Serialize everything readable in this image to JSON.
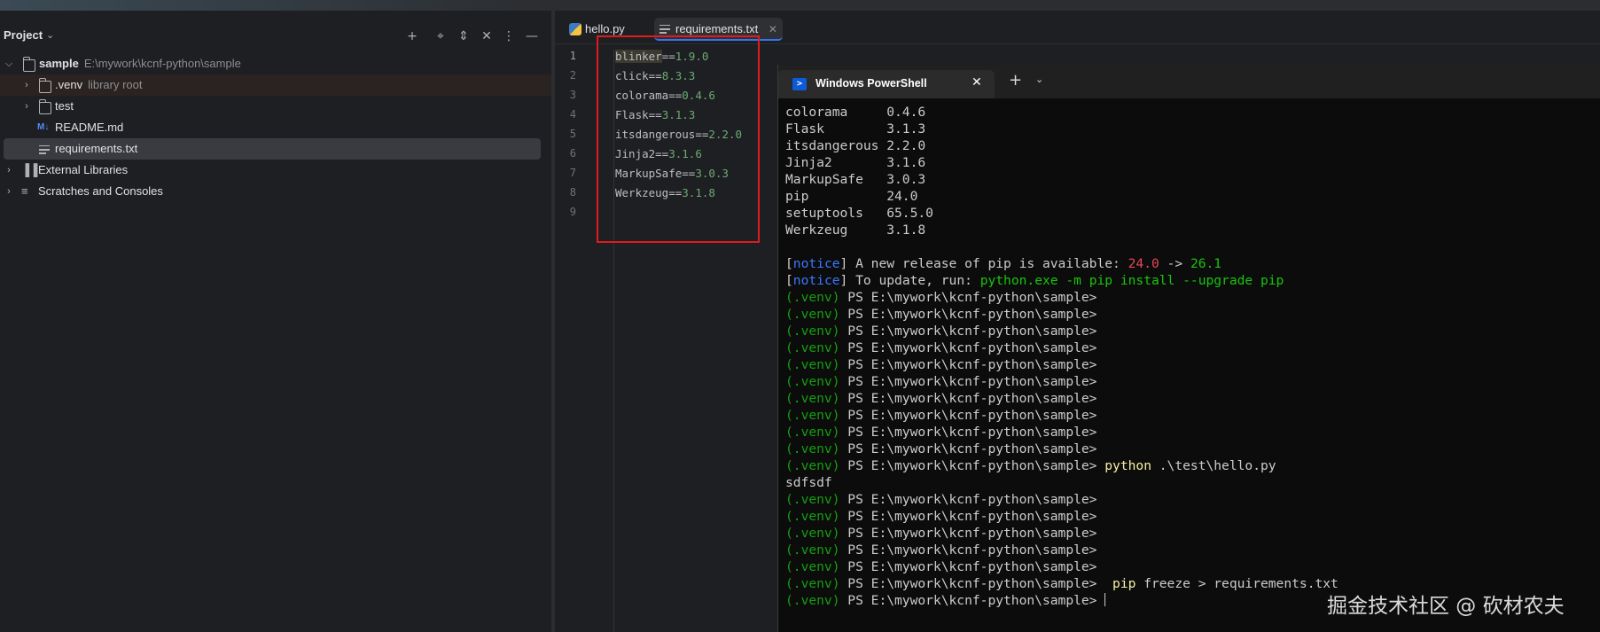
{
  "project": {
    "title": "Project",
    "items": [
      {
        "label": "sample",
        "sub": "E:\\mywork\\kcnf-python\\sample"
      },
      {
        "label": ".venv",
        "sub": "library root"
      },
      {
        "label": "test",
        "sub": ""
      },
      {
        "label": "README.md",
        "sub": "",
        "icon_text": "M↓"
      },
      {
        "label": "requirements.txt",
        "sub": ""
      },
      {
        "label": "External Libraries",
        "sub": ""
      },
      {
        "label": "Scratches and Consoles",
        "sub": ""
      }
    ]
  },
  "editor": {
    "tabs": [
      {
        "label": "hello.py"
      },
      {
        "label": "requirements.txt"
      }
    ],
    "line_numbers": [
      "1",
      "2",
      "3",
      "4",
      "5",
      "6",
      "7",
      "8",
      "9"
    ],
    "lines": [
      {
        "pkg": "blinker",
        "op": "==",
        "ver": "1.9.0"
      },
      {
        "pkg": "click",
        "op": "==",
        "ver": "8.3.3"
      },
      {
        "pkg": "colorama",
        "op": "==",
        "ver": "0.4.6"
      },
      {
        "pkg": "Flask",
        "op": "==",
        "ver": "3.1.3"
      },
      {
        "pkg": "itsdangerous",
        "op": "==",
        "ver": "2.2.0"
      },
      {
        "pkg": "Jinja2",
        "op": "==",
        "ver": "3.1.6"
      },
      {
        "pkg": "MarkupSafe",
        "op": "==",
        "ver": "3.0.3"
      },
      {
        "pkg": "Werkzeug",
        "op": "==",
        "ver": "3.1.8"
      }
    ]
  },
  "terminal": {
    "title": "Windows PowerShell",
    "packages": [
      {
        "name": "colorama    ",
        "ver": " 0.4.6"
      },
      {
        "name": "Flask       ",
        "ver": " 3.1.3"
      },
      {
        "name": "itsdangerous",
        "ver": " 2.2.0"
      },
      {
        "name": "Jinja2      ",
        "ver": " 3.1.6"
      },
      {
        "name": "MarkupSafe  ",
        "ver": " 3.0.3"
      },
      {
        "name": "pip         ",
        "ver": " 24.0"
      },
      {
        "name": "setuptools  ",
        "ver": " 65.5.0"
      },
      {
        "name": "Werkzeug    ",
        "ver": " 3.1.8"
      }
    ],
    "notice_word": "notice",
    "notice1_text": " A new release of pip is available: ",
    "notice1_old": "24.0",
    "notice1_arrow": " -> ",
    "notice1_new": "26.1",
    "notice2_text": " To update, run: ",
    "notice2_cmd": "python.exe -m pip install --upgrade pip",
    "venv": "(.venv)",
    "prompt": " PS E:\\mywork\\kcnf-python\\sample>",
    "run_cmd_word": "python",
    "run_cmd_rest": " .\\test\\hello.py",
    "output": "sdfsdf",
    "freeze_cmd_word": "pip",
    "freeze_cmd_rest": " freeze > requirements.txt"
  },
  "watermark": "掘金技术社区 @ 砍材农夫",
  "colors": {
    "accent": "#3574f0",
    "highlight_box": "#e01b1b",
    "venv_green": "#13a10e"
  }
}
